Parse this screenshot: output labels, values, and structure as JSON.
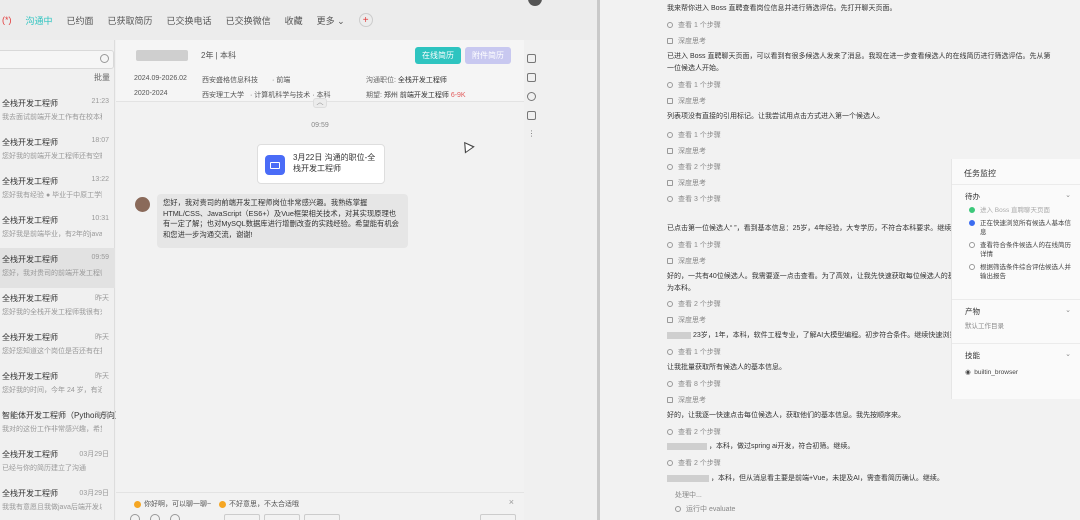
{
  "tabs": [
    "(*)",
    "沟通中",
    "已约面",
    "已获取简历",
    "已交换电话",
    "已交换微信",
    "收藏",
    "更多 ⌄"
  ],
  "batch_label": "批量",
  "contacts": [
    {
      "name": "全栈开发工程师",
      "time": "21:23",
      "preview": "我去面试前端开发工作有在校本科生..."
    },
    {
      "name": "全栈开发工程师",
      "time": "18:07",
      "preview": "您好我的前端开发工程师还有空缺..."
    },
    {
      "name": "全栈开发工程师",
      "time": "13:22",
      "preview": "您好我有经验 ● 毕业于中原工学院"
    },
    {
      "name": "全栈开发工程师",
      "time": "10:31",
      "preview": "您好我是前端毕业，有2年的java后..."
    },
    {
      "name": "全栈开发工程师",
      "time": "09:59",
      "preview": "您好，我对贵司的前端开发工程师岗位非..."
    },
    {
      "name": "全栈开发工程师",
      "time": "昨天",
      "preview": "您好我的全栈开发工程师我很有兴趣..."
    },
    {
      "name": "全栈开发工程师",
      "time": "昨天",
      "preview": "您好您知道这个岗位是否还有在招人..."
    },
    {
      "name": "全栈开发工程师",
      "time": "昨天",
      "preview": "您好我的时间，今年 24 岁，有近 3..."
    },
    {
      "name": "智能体开发工程师（Python方向）",
      "time": "昨天",
      "preview": "我对的这份工作非常感兴趣，希望可..."
    },
    {
      "name": "全栈开发工程师",
      "time": "03月29日",
      "preview": "已经与你的简历建立了沟通"
    },
    {
      "name": "全栈开发工程师",
      "time": "03月29日",
      "preview": "我我有意愿且我做java后端开发以..."
    }
  ],
  "candidate": {
    "years": "2年",
    "degree": "本科",
    "online_resume": "在线简历",
    "attachment_resume": "附件简历",
    "edu": [
      {
        "date": "2024.09-2026.02",
        "school": "西安盛格信息科技",
        "major": "· 前端"
      },
      {
        "date": "2020-2024",
        "school": "西安理工大学",
        "major": "· 计算机科学与技术 · 本科"
      }
    ],
    "position_label": "沟通职位:",
    "position": "全栈开发工程师",
    "expect_label": "期望:",
    "expect_city": "郑州",
    "expect_role": "前端开发工程师",
    "expect_salary": "6-9K"
  },
  "chat": {
    "time": "09:59",
    "card_text": "3月22日 沟通的职位-全栈开发工程师",
    "message": "您好，我对贵司的前端开发工程师岗位非常感兴趣。我熟练掌握HTML/CSS、JavaScript（ES6+）及Vue框架相关技术，对其实现原理也有一定了解；也对MySQL数据库进行增删改查的实践经验。希望能有机会和您进一步沟通交流，谢谢!",
    "quick_replies": [
      "你好啊，可以聊一聊~",
      "不好意思，不太合适哦"
    ]
  },
  "log": [
    {
      "type": "text",
      "text": "我来帮你进入 Boss 直聘查看岗位信息并进行筛选评估。先打开聊天页面。"
    },
    {
      "type": "steps",
      "text": "查看 1 个步骤"
    },
    {
      "type": "think",
      "text": "深度思考"
    },
    {
      "type": "text",
      "text": "已进入 Boss 直聘聊天页面，可以看到有很多候选人发来了消息。我现在进一步查看候选人的在线简历进行筛选评估。先从第"
    },
    {
      "type": "text",
      "text": "一位候选人开始。"
    },
    {
      "type": "steps",
      "text": "查看 1 个步骤"
    },
    {
      "type": "think",
      "text": "深度思考"
    },
    {
      "type": "text",
      "text": "列表项没有直接的引用标记。让我尝试用点击方式进入第一个候选人。"
    },
    {
      "type": "steps",
      "text": "查看 1 个步骤"
    },
    {
      "type": "think",
      "text": "深度思考"
    },
    {
      "type": "steps",
      "text": "查看 2 个步骤"
    },
    {
      "type": "think",
      "text": "深度思考"
    },
    {
      "type": "steps",
      "text": "查看 3 个步骤"
    },
    {
      "type": "text",
      "text": "已点击第一位候选人“        ”，看到基本信息：25岁，4年经验，大专学历，不符合本科要求。继续"
    },
    {
      "type": "steps",
      "text": "查看 1 个步骤"
    },
    {
      "type": "think",
      "text": "深度思考"
    },
    {
      "type": "text",
      "text": "好的，一共有40位候选人。我需要逐一点击查看。为了高效，让我先快速获取每位候选人的基本信"
    },
    {
      "type": "text",
      "text": "为本科。"
    },
    {
      "type": "steps",
      "text": "查看 2 个步骤"
    },
    {
      "type": "think",
      "text": "深度思考"
    },
    {
      "type": "text",
      "text": "    23岁，1年，本科，软件工程专业，了解AI大模型编程。初步符合条件。继续快速浏览其他"
    },
    {
      "type": "steps",
      "text": "查看 1 个步骤"
    },
    {
      "type": "text",
      "text": "让我批量获取所有候选人的基本信息。"
    },
    {
      "type": "steps",
      "text": "查看 8 个步骤"
    },
    {
      "type": "think",
      "text": "深度思考"
    },
    {
      "type": "text",
      "text": "好的，让我逐一快速点击每位候选人，获取他们的基本信息。我先按顺序来。"
    },
    {
      "type": "steps",
      "text": "查看 2 个步骤"
    },
    {
      "type": "text",
      "text": "    ，本科，做过spring ai开发，符合初筛。继续。"
    },
    {
      "type": "steps",
      "text": "查看 2 个步骤"
    },
    {
      "type": "text",
      "text": "      ，本科，但从消息看主要是前端+Vue，未提及AI，需查看简历确认。继续。"
    },
    {
      "type": "processing",
      "text": "处理中..."
    },
    {
      "type": "steps",
      "text": "运行中 evaluate"
    }
  ],
  "panel": {
    "title": "任务监控",
    "todo_label": "待办",
    "tasks": [
      {
        "state": "done",
        "text": "进入 Boss 直聘聊天页面"
      },
      {
        "state": "current",
        "text": "正在快速浏览所有候选人基本信息"
      },
      {
        "state": "pending",
        "text": "查看符合条件候选人的在线简历详情"
      },
      {
        "state": "pending",
        "text": "根据筛选条件综合评估候选人并输出报告"
      }
    ],
    "output_label": "产物",
    "output_value": "默认工作目录",
    "skills_label": "技能",
    "skill": "builtin_browser"
  }
}
